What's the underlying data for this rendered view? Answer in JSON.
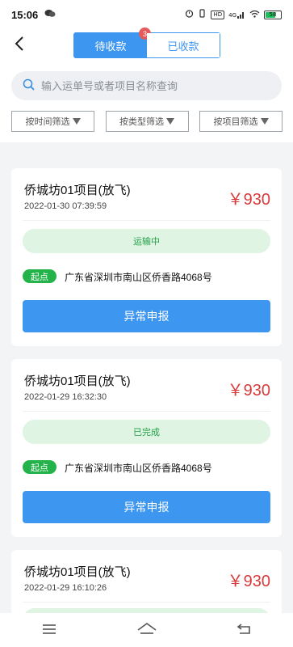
{
  "status_bar": {
    "time": "15:06",
    "hd_label": "HD",
    "network": "4G",
    "battery": "58"
  },
  "header": {
    "tabs": [
      {
        "label": "待收款",
        "badge": "3",
        "active": true
      },
      {
        "label": "已收款",
        "active": false
      }
    ]
  },
  "search": {
    "placeholder": "输入运单号或者项目名称查询"
  },
  "filters": [
    {
      "label": "按时间筛选"
    },
    {
      "label": "按类型筛选"
    },
    {
      "label": "按项目筛选"
    }
  ],
  "orders": [
    {
      "title": "侨城坊01项目(放飞)",
      "date": "2022-01-30 07:39:59",
      "price": "￥930",
      "status": "运输中",
      "start_tag": "起点",
      "address": "广东省深圳市南山区侨香路4068号",
      "button": "异常申报"
    },
    {
      "title": "侨城坊01项目(放飞)",
      "date": "2022-01-29 16:32:30",
      "price": "￥930",
      "status": "已完成",
      "start_tag": "起点",
      "address": "广东省深圳市南山区侨香路4068号",
      "button": "异常申报"
    },
    {
      "title": "侨城坊01项目(放飞)",
      "date": "2022-01-29 16:10:26",
      "price": "￥930",
      "status": "",
      "start_tag": "",
      "address": "",
      "button": ""
    }
  ],
  "colors": {
    "accent": "#3d96f0",
    "price": "#d83b3b",
    "success": "#24b34b",
    "success_bg": "#dff4e3",
    "badge": "#e45a5a"
  },
  "icons": {
    "back": "back-arrow-icon",
    "search": "search-icon",
    "nav_menu": "menu-icon",
    "nav_home": "home-icon",
    "nav_back": "return-icon"
  }
}
